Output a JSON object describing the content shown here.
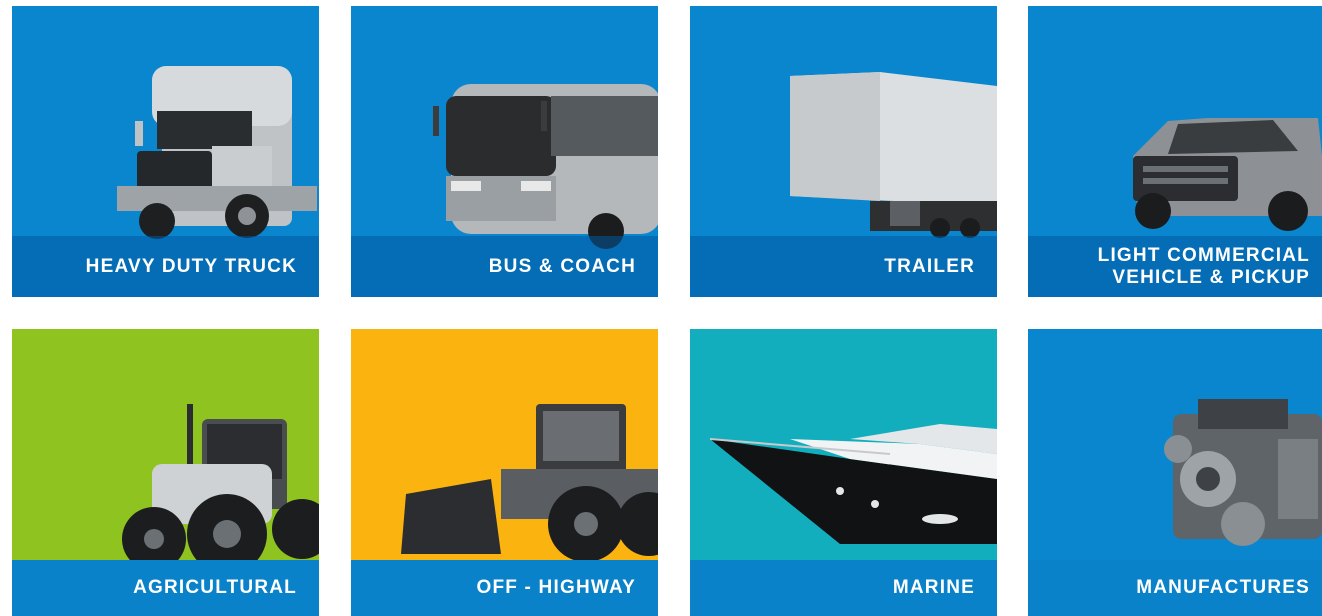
{
  "tiles": [
    {
      "label": "HEAVY DUTY TRUCK",
      "icon": "truck-icon",
      "color": "#0a86cf"
    },
    {
      "label": "BUS & COACH",
      "icon": "bus-icon",
      "color": "#0a86cf"
    },
    {
      "label": "TRAILER",
      "icon": "trailer-icon",
      "color": "#0a86cf"
    },
    {
      "label_line1": "LIGHT COMMERCIAL",
      "label_line2": "VEHICLE & PICKUP",
      "icon": "pickup-icon",
      "color": "#0a86cf"
    },
    {
      "label": "AGRICULTURAL",
      "icon": "tractor-icon",
      "color": "#8fc320"
    },
    {
      "label": "OFF - HIGHWAY",
      "icon": "loader-icon",
      "color": "#fbb40f"
    },
    {
      "label": "MARINE",
      "icon": "yacht-icon",
      "color": "#13aebd"
    },
    {
      "label": "MANUFACTURES",
      "icon": "engine-icon",
      "color": "#0a86cf"
    }
  ]
}
